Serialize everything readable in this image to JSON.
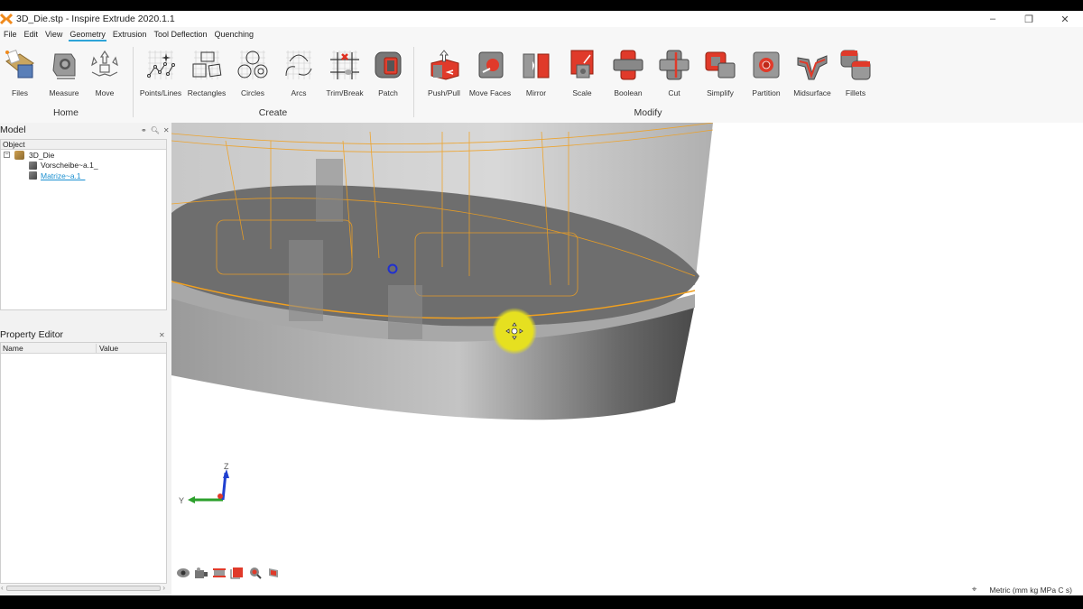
{
  "window": {
    "title": "3D_Die.stp - Inspire Extrude 2020.1.1",
    "controls": {
      "minimize": "–",
      "restore": "❐",
      "close": "✕"
    }
  },
  "menu": {
    "items": [
      "File",
      "Edit",
      "View",
      "Geometry",
      "Extrusion",
      "Tool Deflection",
      "Quenching"
    ],
    "active": "Geometry"
  },
  "ribbon": {
    "groups": [
      {
        "label": "Home",
        "tools": [
          "Files",
          "Measure",
          "Move"
        ]
      },
      {
        "label": "Create",
        "tools": [
          "Points/Lines",
          "Rectangles",
          "Circles",
          "Arcs",
          "Trim/Break",
          "Patch"
        ]
      },
      {
        "label": "Modify",
        "tools": [
          "Push/Pull",
          "Move Faces",
          "Mirror",
          "Scale",
          "Boolean",
          "Cut",
          "Simplify",
          "Partition",
          "Midsurface",
          "Fillets"
        ]
      }
    ]
  },
  "model_panel": {
    "title": "Model",
    "column": "Object",
    "tree": [
      {
        "label": "3D_Die",
        "level": 0,
        "expander": "−",
        "icon": "assembly-icon"
      },
      {
        "label": "Vorscheibe~a.1_",
        "level": 1,
        "icon": "part-icon"
      },
      {
        "label": "Matrize~a.1_",
        "level": 1,
        "icon": "part-icon",
        "selected": true
      }
    ]
  },
  "property_panel": {
    "title": "Property Editor",
    "columns": [
      "Name",
      "Value"
    ]
  },
  "viewport": {
    "axis_labels": {
      "z": "Z",
      "y": "Y"
    },
    "colors": {
      "highlight": "#f0a020",
      "cursor_halo": "#e6e020",
      "pivot": "#2030d0"
    }
  },
  "view_tools": [
    "view-visibility-icon",
    "camera-icon",
    "section-icon",
    "box-select-icon",
    "zoom-fit-icon",
    "view-cube-icon"
  ],
  "status": {
    "units": "Metric (mm kg MPa C s)"
  }
}
